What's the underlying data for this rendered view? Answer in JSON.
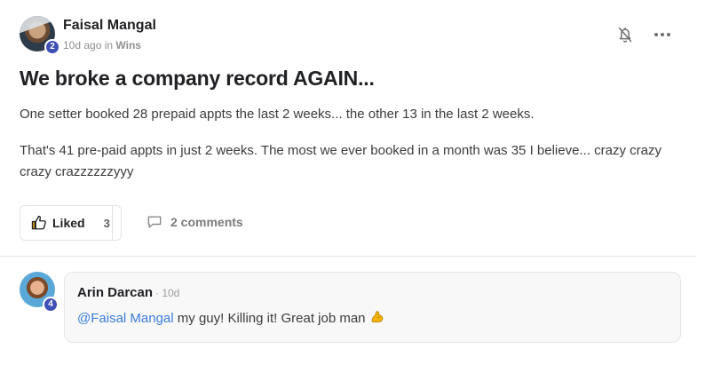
{
  "post": {
    "author": {
      "name": "Faisal Mangal",
      "level": "2"
    },
    "meta": {
      "time": "10d ago",
      "in": " in ",
      "category": "Wins"
    },
    "title": "We broke a company record AGAIN...",
    "paragraphs": [
      "One setter booked 28 prepaid appts the last 2 weeks... the other 13 in the last 2 weeks.",
      "That's 41 pre-paid appts in just 2 weeks. The most we ever booked in a month was 35 I believe... crazy crazy crazy crazzzzzzyyy"
    ],
    "actions": {
      "like_label": "Liked",
      "like_count": "3",
      "comments_label": "2 comments"
    },
    "icons": {
      "notify": "bell-off-icon",
      "more": "more-horizontal-icon",
      "like": "thumbs-up-icon",
      "comment": "comment-bubble-icon"
    }
  },
  "comment": {
    "author": {
      "name": "Arin Darcan",
      "level": "4"
    },
    "time": "· 10d",
    "mention": "@Faisal Mangal",
    "text": " my guy! Killing it! Great job man",
    "emoji": "flexed-biceps"
  },
  "colors": {
    "badge": "#3f51b5",
    "mention": "#3b7ddd",
    "like_icon": "#e8a317"
  }
}
